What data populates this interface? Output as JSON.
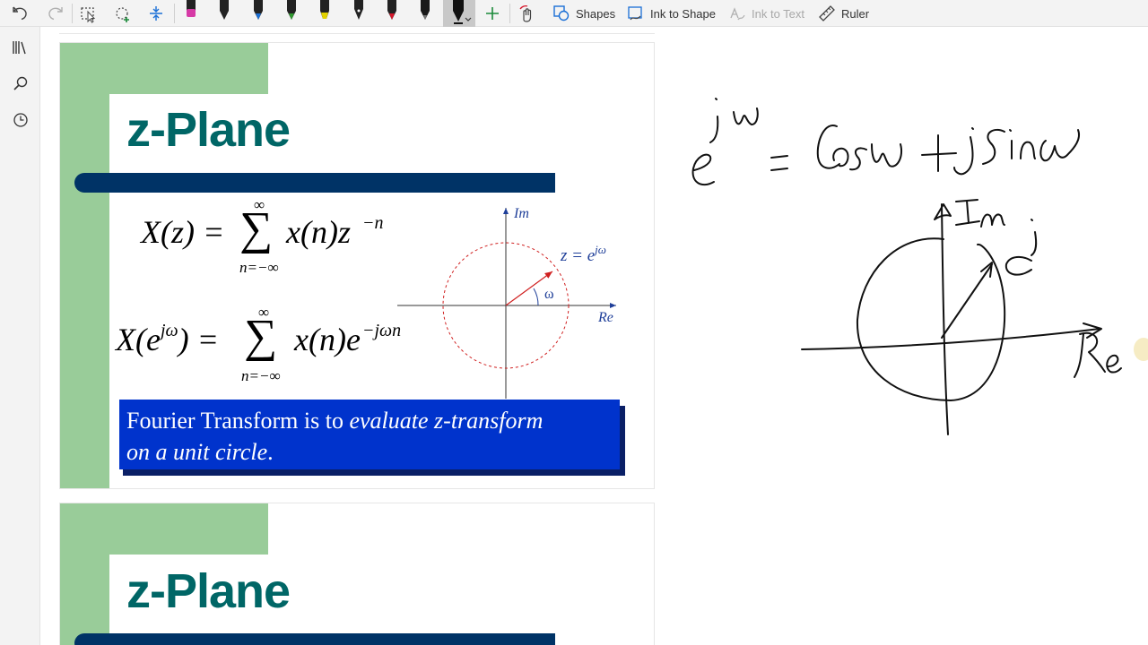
{
  "toolbar": {
    "shapes_label": "Shapes",
    "ink_to_shape_label": "Ink to Shape",
    "ink_to_text_label": "Ink to Text",
    "ruler_label": "Ruler",
    "pen_colors": [
      "#222222",
      "#1a6fd6",
      "#2e9a2e",
      "#e2d200",
      "#222222",
      "#d6162a",
      "#1a1a1a",
      "#111111"
    ],
    "highlighter_color": "#d63aa6",
    "accent_color": "#1b8a3a"
  },
  "slide1": {
    "title": "z-Plane",
    "eq1": {
      "lhs": "X(z) =",
      "sum_top": "∞",
      "sum_bottom": "n=−∞",
      "body": "x(n)z",
      "exp": "−n"
    },
    "eq2": {
      "lhs_a": "X(e",
      "lhs_exp": "jω",
      "lhs_b": ") =",
      "sum_top": "∞",
      "sum_bottom": "n=−∞",
      "body": "x(n)e",
      "exp": "−jωn"
    },
    "diagram": {
      "im_label": "Im",
      "re_label": "Re",
      "z_label": "z = e",
      "z_exp": "jω",
      "omega_label": "ω"
    },
    "note_plain": "Fourier Transform is to ",
    "note_italic_1": "evaluate z-transform",
    "note_italic_2": "on a unit circle",
    "note_end": "."
  },
  "slide2": {
    "title": "z-Plane"
  },
  "colors": {
    "slide_green": "#99cc99",
    "title_teal": "#006666",
    "bar_navy": "#003366",
    "box_blue": "#0033cc",
    "diagram_blue": "#1f3f99",
    "circle_red": "#d02020"
  }
}
